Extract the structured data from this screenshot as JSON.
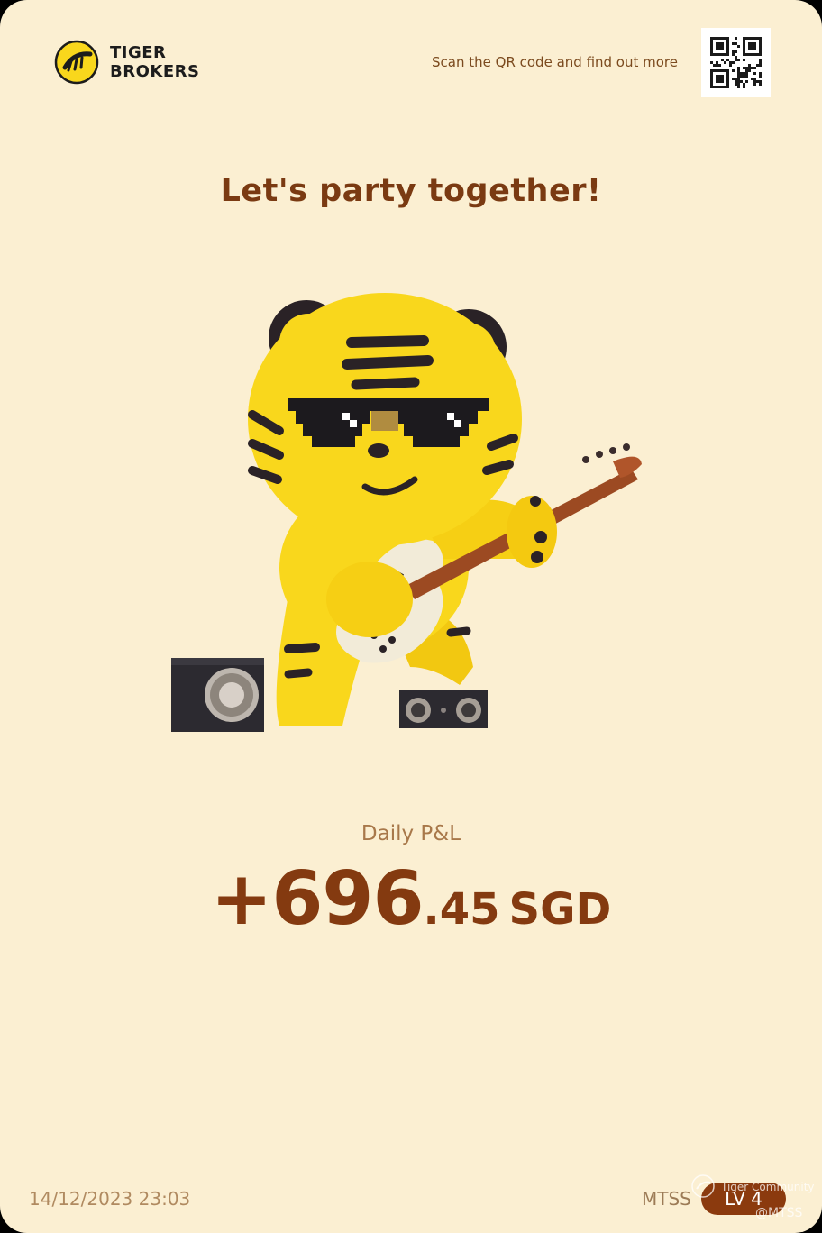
{
  "brand": {
    "name_line1": "TIGER",
    "name_line2": "BROKERS",
    "logo_icon": "tiger-stripes-icon",
    "color": "#f9d71c"
  },
  "header": {
    "qr_caption": "Scan the QR code and find out more",
    "qr_icon": "qr-code"
  },
  "headline": "Let's party together!",
  "illustration": {
    "subject": "tiger-mascot-playing-guitar",
    "props": [
      "speaker-left",
      "speaker-right",
      "bass-guitar",
      "pixel-sunglasses"
    ]
  },
  "pnl": {
    "label": "Daily P&L",
    "integer": "+696",
    "decimal": ".45",
    "currency": "SGD"
  },
  "footer": {
    "timestamp": "14/12/2023 23:03",
    "username": "MTSS",
    "level": "LV 4"
  },
  "watermark": {
    "name": "Tiger Community",
    "handle": "@MTSS"
  },
  "colors": {
    "background": "#fbefd2",
    "accent": "#843a10",
    "mascot": "#f9d71c"
  }
}
